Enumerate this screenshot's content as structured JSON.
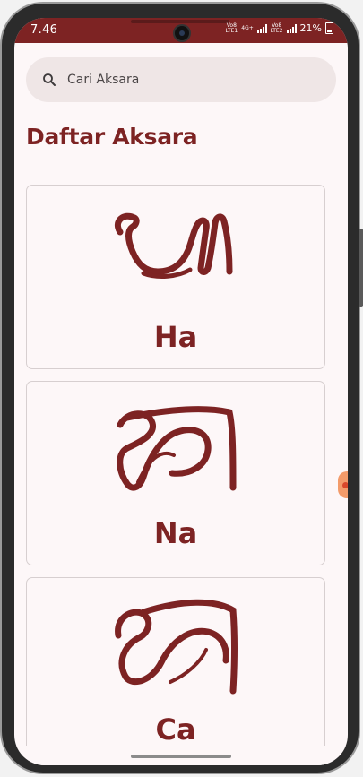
{
  "status": {
    "time": "7.46",
    "net1_top": "Vo8",
    "net1_bottom": "LTE1",
    "net2_top": "Vo8",
    "net2_bottom": "LTE2",
    "speed": "4G+",
    "battery": "21%"
  },
  "search": {
    "placeholder": "Cari Aksara",
    "icon": "search-icon"
  },
  "page": {
    "title": "Daftar Aksara"
  },
  "aksara": [
    {
      "label": "Ha"
    },
    {
      "label": "Na"
    },
    {
      "label": "Ca"
    }
  ],
  "colors": {
    "primary": "#7d2323",
    "background": "#fdf7f8",
    "search_bg": "#efe6e6"
  }
}
